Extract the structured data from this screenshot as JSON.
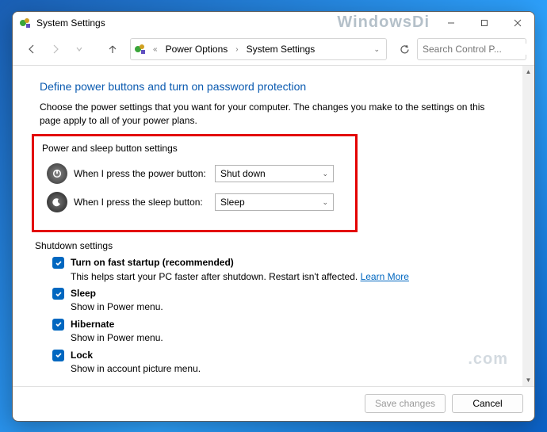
{
  "window": {
    "title": "System Settings",
    "watermark_top": "WindowsDi",
    "watermark_body": ".com"
  },
  "breadcrumb": {
    "items": [
      "Power Options",
      "System Settings"
    ]
  },
  "search": {
    "placeholder": "Search Control P..."
  },
  "page": {
    "title": "Define power buttons and turn on password protection",
    "description": "Choose the power settings that you want for your computer. The changes you make to the settings on this page apply to all of your power plans."
  },
  "power_group": {
    "label": "Power and sleep button settings",
    "rows": [
      {
        "label": "When I press the power button:",
        "value": "Shut down"
      },
      {
        "label": "When I press the sleep button:",
        "value": "Sleep"
      }
    ]
  },
  "shutdown": {
    "label": "Shutdown settings",
    "items": [
      {
        "title": "Turn on fast startup (recommended)",
        "sub": "This helps start your PC faster after shutdown. Restart isn't affected. ",
        "link": "Learn More"
      },
      {
        "title": "Sleep",
        "sub": "Show in Power menu."
      },
      {
        "title": "Hibernate",
        "sub": "Show in Power menu."
      },
      {
        "title": "Lock",
        "sub": "Show in account picture menu."
      }
    ]
  },
  "footer": {
    "save": "Save changes",
    "cancel": "Cancel"
  }
}
